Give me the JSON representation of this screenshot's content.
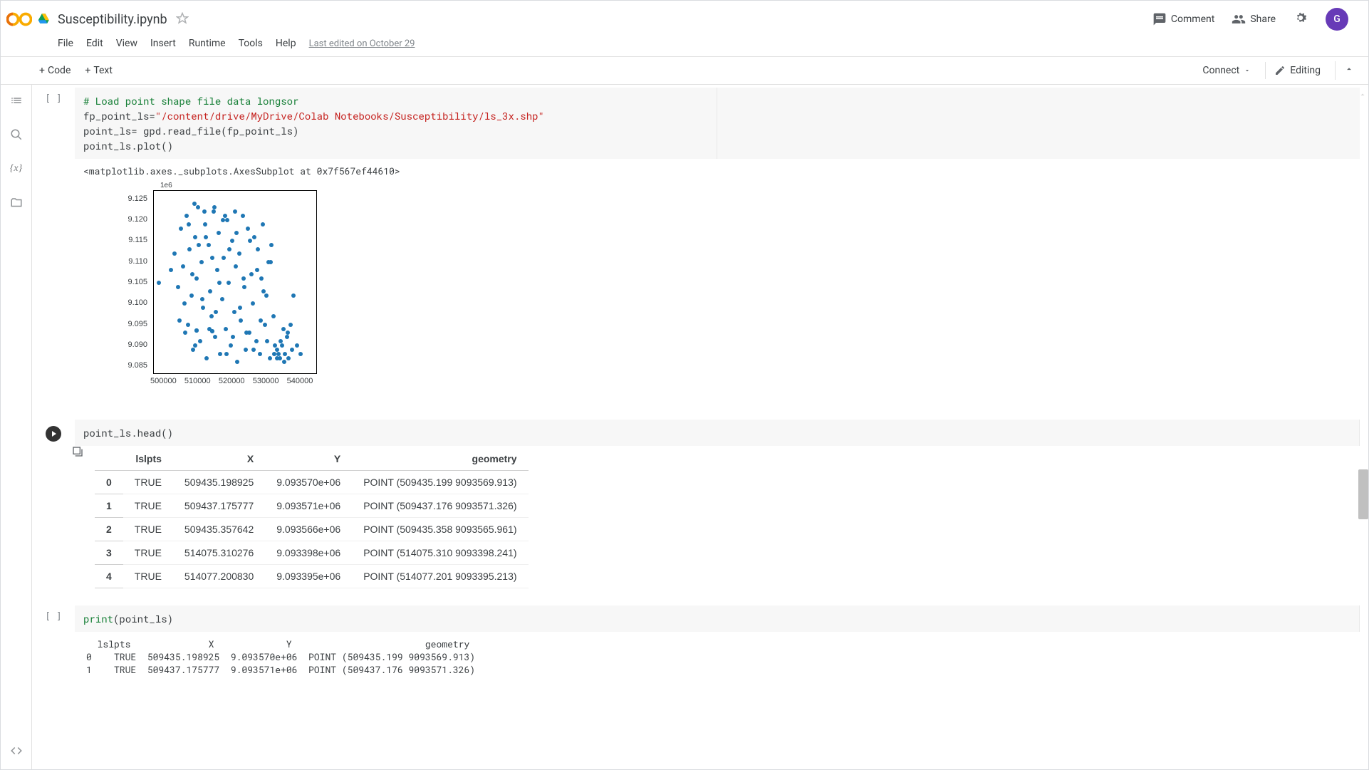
{
  "header": {
    "title": "Susceptibility.ipynb",
    "comment_label": "Comment",
    "share_label": "Share",
    "avatar_initial": "G"
  },
  "menubar": {
    "items": [
      "File",
      "Edit",
      "View",
      "Insert",
      "Runtime",
      "Tools",
      "Help"
    ],
    "last_edited": "Last edited on October 29"
  },
  "toolbar": {
    "code_label": "Code",
    "text_label": "Text",
    "connect_label": "Connect",
    "editing_label": "Editing"
  },
  "cell1": {
    "comment": "# Load point shape file data longsor",
    "line2a": "fp_point_ls=",
    "line2b": "\"/content/drive/MyDrive/Colab Notebooks/Susceptibility/ls_3x.shp\"",
    "line3": "point_ls= gpd.read_file(fp_point_ls)",
    "line4": "point_ls.plot()",
    "output_repr": "<matplotlib.axes._subplots.AxesSubplot at 0x7f567ef44610>"
  },
  "chart_data": {
    "type": "scatter",
    "xlabel": "",
    "ylabel": "",
    "y_exp_label": "1e6",
    "xlim": [
      497000,
      545000
    ],
    "ylim": [
      9.083,
      9.127
    ],
    "x_ticks": [
      500000,
      510000,
      520000,
      530000,
      540000
    ],
    "y_ticks": [
      9.085,
      9.09,
      9.095,
      9.1,
      9.105,
      9.11,
      9.115,
      9.12,
      9.125
    ],
    "points": [
      [
        509435,
        9.09357
      ],
      [
        509437,
        9.09357
      ],
      [
        509435,
        9.09357
      ],
      [
        514075,
        9.0934
      ],
      [
        514077,
        9.09339
      ],
      [
        502000,
        9.108
      ],
      [
        504000,
        9.104
      ],
      [
        505000,
        9.118
      ],
      [
        506000,
        9.1
      ],
      [
        506500,
        9.121
      ],
      [
        507000,
        9.095
      ],
      [
        507500,
        9.113
      ],
      [
        508000,
        9.102
      ],
      [
        508500,
        9.089
      ],
      [
        509000,
        9.116
      ],
      [
        509500,
        9.106
      ],
      [
        510000,
        9.123
      ],
      [
        510500,
        9.091
      ],
      [
        511000,
        9.11
      ],
      [
        511500,
        9.099
      ],
      [
        512000,
        9.119
      ],
      [
        512500,
        9.087
      ],
      [
        513000,
        9.114
      ],
      [
        513500,
        9.103
      ],
      [
        514000,
        9.097
      ],
      [
        514500,
        9.122
      ],
      [
        515000,
        9.092
      ],
      [
        515500,
        9.108
      ],
      [
        516000,
        9.117
      ],
      [
        516500,
        9.088
      ],
      [
        517000,
        9.101
      ],
      [
        517500,
        9.111
      ],
      [
        518000,
        9.094
      ],
      [
        518500,
        9.12
      ],
      [
        519000,
        9.105
      ],
      [
        519500,
        9.09
      ],
      [
        520000,
        9.115
      ],
      [
        520500,
        9.098
      ],
      [
        521000,
        9.109
      ],
      [
        521500,
        9.086
      ],
      [
        522000,
        9.112
      ],
      [
        522500,
        9.096
      ],
      [
        523000,
        9.121
      ],
      [
        523500,
        9.104
      ],
      [
        524000,
        9.089
      ],
      [
        524500,
        9.118
      ],
      [
        525000,
        9.093
      ],
      [
        525500,
        9.107
      ],
      [
        526000,
        9.1
      ],
      [
        526500,
        9.116
      ],
      [
        527000,
        9.091
      ],
      [
        527500,
        9.113
      ],
      [
        528000,
        9.088
      ],
      [
        528500,
        9.106
      ],
      [
        529000,
        9.119
      ],
      [
        529500,
        9.095
      ],
      [
        530000,
        9.102
      ],
      [
        530500,
        9.11
      ],
      [
        531000,
        9.087
      ],
      [
        531500,
        9.114
      ],
      [
        532000,
        9.097
      ],
      [
        532500,
        9.09
      ],
      [
        533000,
        9.089
      ],
      [
        533500,
        9.088
      ],
      [
        534000,
        9.087
      ],
      [
        534500,
        9.09
      ],
      [
        535000,
        9.094
      ],
      [
        535500,
        9.088
      ],
      [
        536000,
        9.092
      ],
      [
        536500,
        9.087
      ],
      [
        537000,
        9.095
      ],
      [
        537500,
        9.089
      ],
      [
        538000,
        9.102
      ],
      [
        539000,
        9.09
      ],
      [
        540000,
        9.088
      ],
      [
        503000,
        9.112
      ],
      [
        504500,
        9.096
      ],
      [
        505500,
        9.109
      ],
      [
        506200,
        9.093
      ],
      [
        507200,
        9.119
      ],
      [
        508200,
        9.107
      ],
      [
        509200,
        9.09
      ],
      [
        510200,
        9.114
      ],
      [
        511200,
        9.101
      ],
      [
        512200,
        9.116
      ],
      [
        513200,
        9.094
      ],
      [
        514200,
        9.111
      ],
      [
        515200,
        9.098
      ],
      [
        516200,
        9.105
      ],
      [
        517200,
        9.12
      ],
      [
        518200,
        9.088
      ],
      [
        519200,
        9.113
      ],
      [
        520200,
        9.092
      ],
      [
        521200,
        9.117
      ],
      [
        522200,
        9.099
      ],
      [
        523200,
        9.106
      ],
      [
        524200,
        9.093
      ],
      [
        525200,
        9.115
      ],
      [
        526200,
        9.089
      ],
      [
        527200,
        9.108
      ],
      [
        528200,
        9.096
      ],
      [
        529200,
        9.103
      ],
      [
        530200,
        9.091
      ],
      [
        531200,
        9.11
      ],
      [
        532200,
        9.088
      ],
      [
        533200,
        9.087
      ],
      [
        534200,
        9.091
      ],
      [
        535200,
        9.086
      ],
      [
        536200,
        9.093
      ],
      [
        508800,
        9.124
      ],
      [
        511800,
        9.122
      ],
      [
        514800,
        9.123
      ],
      [
        517800,
        9.121
      ],
      [
        520800,
        9.122
      ],
      [
        498500,
        9.105
      ]
    ]
  },
  "cell2": {
    "code": "point_ls.head()",
    "columns": [
      "lslpts",
      "X",
      "Y",
      "geometry"
    ],
    "rows": [
      {
        "idx": "0",
        "lslpts": "TRUE",
        "X": "509435.198925",
        "Y": "9.093570e+06",
        "geometry": "POINT (509435.199 9093569.913)"
      },
      {
        "idx": "1",
        "lslpts": "TRUE",
        "X": "509437.175777",
        "Y": "9.093571e+06",
        "geometry": "POINT (509437.176 9093571.326)"
      },
      {
        "idx": "2",
        "lslpts": "TRUE",
        "X": "509435.357642",
        "Y": "9.093566e+06",
        "geometry": "POINT (509435.358 9093565.961)"
      },
      {
        "idx": "3",
        "lslpts": "TRUE",
        "X": "514075.310276",
        "Y": "9.093398e+06",
        "geometry": "POINT (514075.310 9093398.241)"
      },
      {
        "idx": "4",
        "lslpts": "TRUE",
        "X": "514077.200830",
        "Y": "9.093395e+06",
        "geometry": "POINT (514077.201 9093395.213)"
      }
    ]
  },
  "cell3": {
    "code_kw": "print",
    "code_rest": "(point_ls)",
    "output_header": "  lslpts              X             Y                        geometry",
    "output_lines": [
      "0    TRUE  509435.198925  9.093570e+06  POINT (509435.199 9093569.913)",
      "1    TRUE  509437.175777  9.093571e+06  POINT (509437.176 9093571.326)"
    ]
  }
}
